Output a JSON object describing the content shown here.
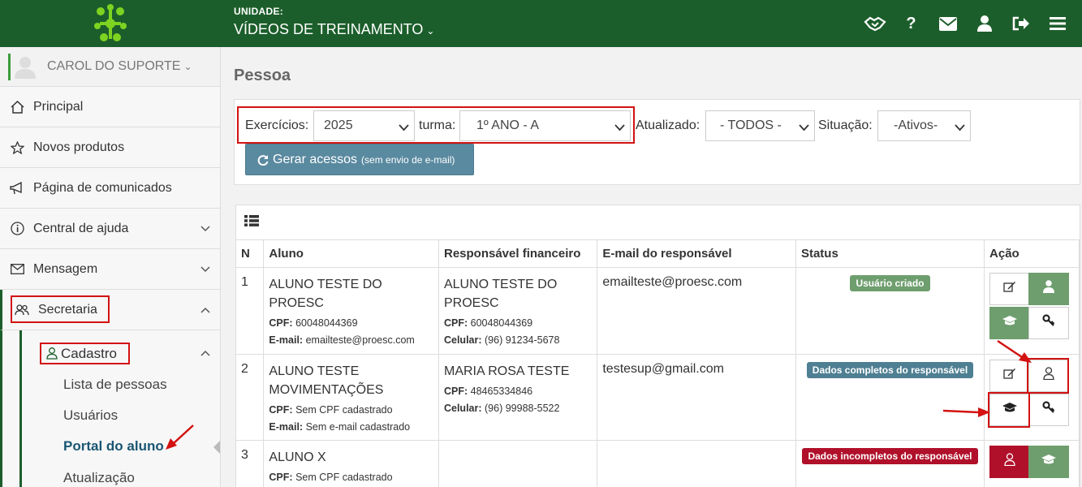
{
  "topbar": {
    "unit_label": "UNIDADE:",
    "unit_name": "VÍDEOS DE TREINAMENTO",
    "icons": [
      "handshake-icon",
      "help-icon",
      "mail-icon",
      "user-icon",
      "logout-icon",
      "menu-icon"
    ],
    "help_glyph": "?"
  },
  "sidebar": {
    "user_name": "CAROL DO SUPORTE",
    "items": [
      {
        "label": "Principal",
        "icon": "home-icon"
      },
      {
        "label": "Novos produtos",
        "icon": "star-icon"
      },
      {
        "label": "Página de comunicados",
        "icon": "megaphone-icon"
      },
      {
        "label": "Central de ajuda",
        "icon": "info-icon"
      },
      {
        "label": "Mensagem",
        "icon": "envelope-icon"
      },
      {
        "label": "Secretaria",
        "icon": "users-icon"
      }
    ],
    "cadastro_label": "Cadastro",
    "sub_links": [
      "Lista de pessoas",
      "Usuários",
      "Portal do aluno",
      "Atualização"
    ]
  },
  "main": {
    "page_title": "Pessoa",
    "filters": {
      "exercicios_label": "Exercícios:",
      "exercicios_value": "2025",
      "turma_label": "turma:",
      "turma_value": "1º ANO - A",
      "atualizado_label": "Atualizado:",
      "atualizado_value": "- TODOS -",
      "situacao_label": "Situação:",
      "situacao_value": "-Ativos-"
    },
    "generate_button": {
      "label": "Gerar acessos",
      "note": "(sem envio de e-mail)"
    },
    "table": {
      "headers": [
        "N",
        "Aluno",
        "Responsável financeiro",
        "E-mail do responsável",
        "Status",
        "Ação"
      ],
      "rows": [
        {
          "n": "1",
          "aluno_nome": "ALUNO TESTE DO PROESC",
          "aluno_cpf_label": "CPF:",
          "aluno_cpf": "60048044369",
          "aluno_email_label": "E-mail:",
          "aluno_email": "emailteste@proesc.com",
          "resp_nome": "ALUNO TESTE DO PROESC",
          "resp_cpf_label": "CPF:",
          "resp_cpf": "60048044369",
          "resp_cel_label": "Celular:",
          "resp_cel": "(96) 91234-5678",
          "email_resp": "emailteste@proesc.com",
          "status": "Usuário criado",
          "status_color": "#6e9e6e"
        },
        {
          "n": "2",
          "aluno_nome": "ALUNO TESTE MOVIMENTAÇÕES",
          "aluno_cpf_label": "CPF:",
          "aluno_cpf": "Sem CPF cadastrado",
          "aluno_email_label": "E-mail:",
          "aluno_email": "Sem e-mail cadastrado",
          "resp_nome": "MARIA ROSA TESTE",
          "resp_cpf_label": "CPF:",
          "resp_cpf": "48465334846",
          "resp_cel_label": "Celular:",
          "resp_cel": "(96) 99988-5522",
          "email_resp": "testesup@gmail.com",
          "status": "Dados completos do responsável",
          "status_color": "#4e7f92"
        },
        {
          "n": "3",
          "aluno_nome": "ALUNO X",
          "aluno_cpf_label": "CPF:",
          "aluno_cpf": "Sem CPF cadastrado",
          "status": "Dados incompletos do responsável",
          "status_color": "#b0102a"
        }
      ]
    }
  },
  "colors": {
    "brand": "#1c5e2b",
    "button": "#5a8aa0",
    "highlight": "#d31212"
  }
}
